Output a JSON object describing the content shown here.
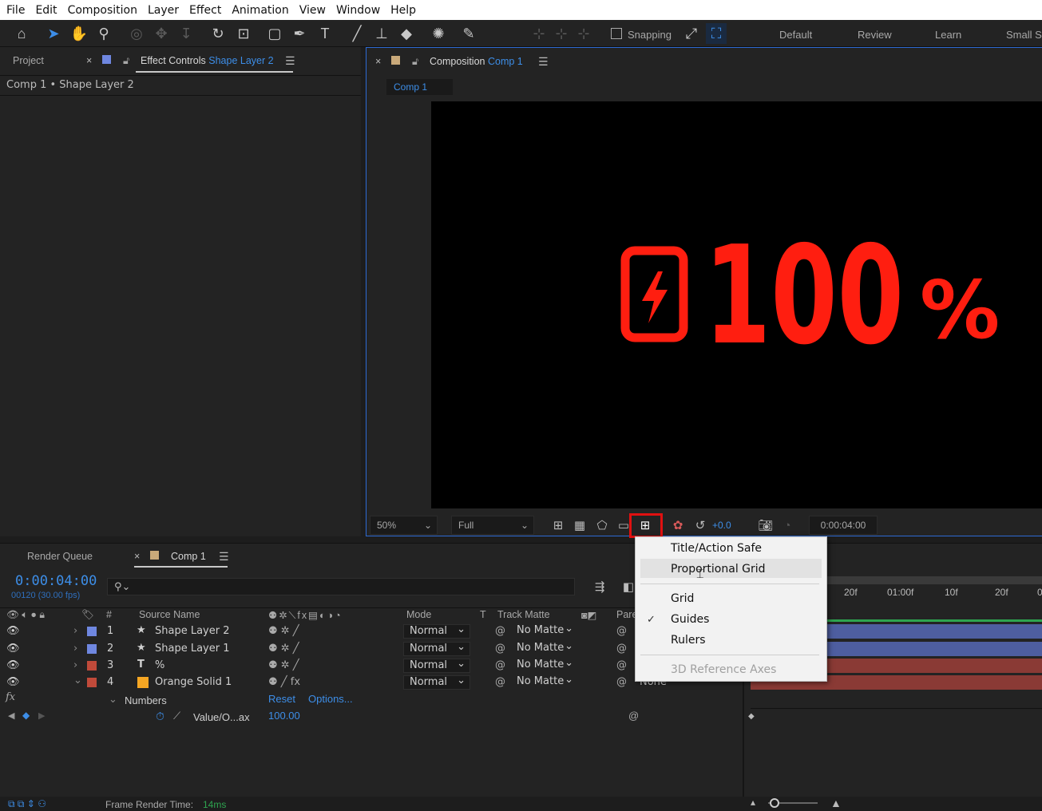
{
  "menubar": [
    "File",
    "Edit",
    "Composition",
    "Layer",
    "Effect",
    "Animation",
    "View",
    "Window",
    "Help"
  ],
  "toolbar": {
    "snapping_label": "Snapping",
    "workspaces": [
      "Default",
      "Review",
      "Learn",
      "Small S"
    ]
  },
  "left_panel": {
    "tab_project": "Project",
    "tab_effect_controls": "Effect Controls",
    "tab_effect_controls_target": "Shape Layer 2",
    "breadcrumb": "Comp 1 • Shape Layer 2"
  },
  "viewer": {
    "tab_label": "Composition",
    "tab_target": "Comp 1",
    "comp_tab": "Comp 1",
    "battery_text": "100",
    "percent_text": "%",
    "zoom": "50%",
    "resolution": "Full",
    "exposure": "+0.0",
    "timecode": "0:00:04:00",
    "text_color": "#ff1e10"
  },
  "dropdown": {
    "items": [
      {
        "label": "Title/Action Safe",
        "checked": false,
        "disabled": false
      },
      {
        "label": "Proportional Grid",
        "checked": false,
        "disabled": false
      },
      {
        "label": "Grid",
        "checked": false,
        "disabled": false
      },
      {
        "label": "Guides",
        "checked": true,
        "disabled": false
      },
      {
        "label": "Rulers",
        "checked": false,
        "disabled": false
      },
      {
        "label": "3D Reference Axes",
        "checked": false,
        "disabled": true
      }
    ]
  },
  "timeline": {
    "tab_render_queue": "Render Queue",
    "tab_comp": "Comp 1",
    "current_time": "0:00:04:00",
    "frame_info": "00120 (30.00 fps)",
    "search_placeholder": "",
    "columns": {
      "num": "#",
      "source_name": "Source Name",
      "mode": "Mode",
      "t": "T",
      "track_matte": "Track Matte",
      "parent": "Pare"
    },
    "ruler": [
      "20f",
      "01:00f",
      "10f",
      "20f",
      "0"
    ],
    "layers": [
      {
        "num": "1",
        "name": "Shape Layer 2",
        "type": "star",
        "color": "#6f87e0",
        "mode": "Normal",
        "matte": "No Matte",
        "bar_color": "#4e5ea0"
      },
      {
        "num": "2",
        "name": "Shape Layer 1",
        "type": "star",
        "color": "#6f87e0",
        "mode": "Normal",
        "matte": "No Matte",
        "bar_color": "#4e5ea0"
      },
      {
        "num": "3",
        "name": "%",
        "type": "text",
        "color": "#c04a3a",
        "mode": "Normal",
        "matte": "No Matte",
        "bar_color": "#8a3a35"
      },
      {
        "num": "4",
        "name": "Orange Solid 1",
        "type": "solid",
        "color": "#c04a3a",
        "solid_color": "#f5a623",
        "mode": "Normal",
        "matte": "No Matte",
        "parent": "None",
        "bar_color": "#8a3a35"
      }
    ],
    "effect_name": "Numbers",
    "effect_reset": "Reset",
    "effect_options": "Options...",
    "property_name": "Value/O...ax",
    "property_value": "100.00"
  },
  "status": {
    "frame_render_label": "Frame Render Time:",
    "frame_render_value": "14ms"
  }
}
